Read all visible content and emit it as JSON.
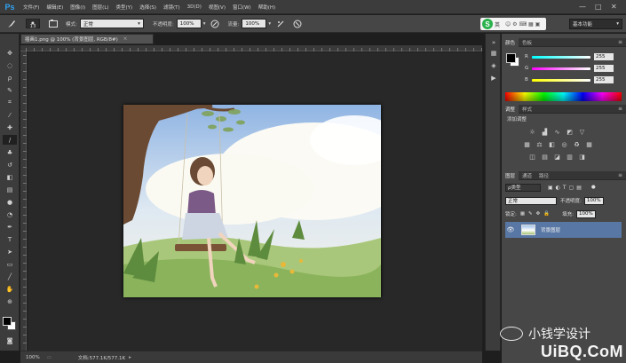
{
  "app": {
    "logo": "Ps"
  },
  "menubar": {
    "items": [
      "文件(F)",
      "编辑(E)",
      "图像(I)",
      "图层(L)",
      "类型(Y)",
      "选择(S)",
      "滤镜(T)",
      "3D(D)",
      "视图(V)",
      "窗口(W)",
      "帮助(H)"
    ],
    "window_controls": [
      "—",
      "□",
      "✕"
    ]
  },
  "options_bar": {
    "brush_size": "13",
    "mode_label": "模式:",
    "mode_value": "正常",
    "opacity_label": "不透明度:",
    "opacity_value": "100%",
    "flow_label": "流量:",
    "flow_value": "100%"
  },
  "badge": {
    "letter": "S",
    "label": "英"
  },
  "workspace": {
    "label": "基本功能"
  },
  "document": {
    "tab_title": "插画1.png @ 100% (背景图层, RGB/8#)",
    "close": "×"
  },
  "status": {
    "zoom": "100%",
    "doc_info": "文档:577.1K/577.1K"
  },
  "panels": {
    "color_tabs": [
      "颜色",
      "色板"
    ],
    "color": {
      "rows": [
        {
          "label": "R",
          "value": "255"
        },
        {
          "label": "G",
          "value": "255"
        },
        {
          "label": "B",
          "value": "255"
        }
      ]
    },
    "adjust_tabs": [
      "调整",
      "样式"
    ],
    "adjust_title": "添加调整",
    "layers_tabs": [
      "图层",
      "通道",
      "路径"
    ],
    "layers": {
      "kind_value": "ρ类型",
      "blend_value": "正常",
      "opacity_label": "不透明度:",
      "opacity_value": "100%",
      "lock_label": "锁定:",
      "fill_label": "填充:",
      "fill_value": "100%",
      "items": [
        {
          "name": "背景图层",
          "visible_icon": "👁"
        }
      ]
    }
  },
  "watermark": {
    "text": "小钱学设计",
    "brand": "UiBQ.CoM"
  },
  "colors": {
    "menubar_bg": "#3c3c3c",
    "panel_bg": "#474747",
    "workspace_bg": "#282828",
    "layer_selected": "#5877a4"
  }
}
